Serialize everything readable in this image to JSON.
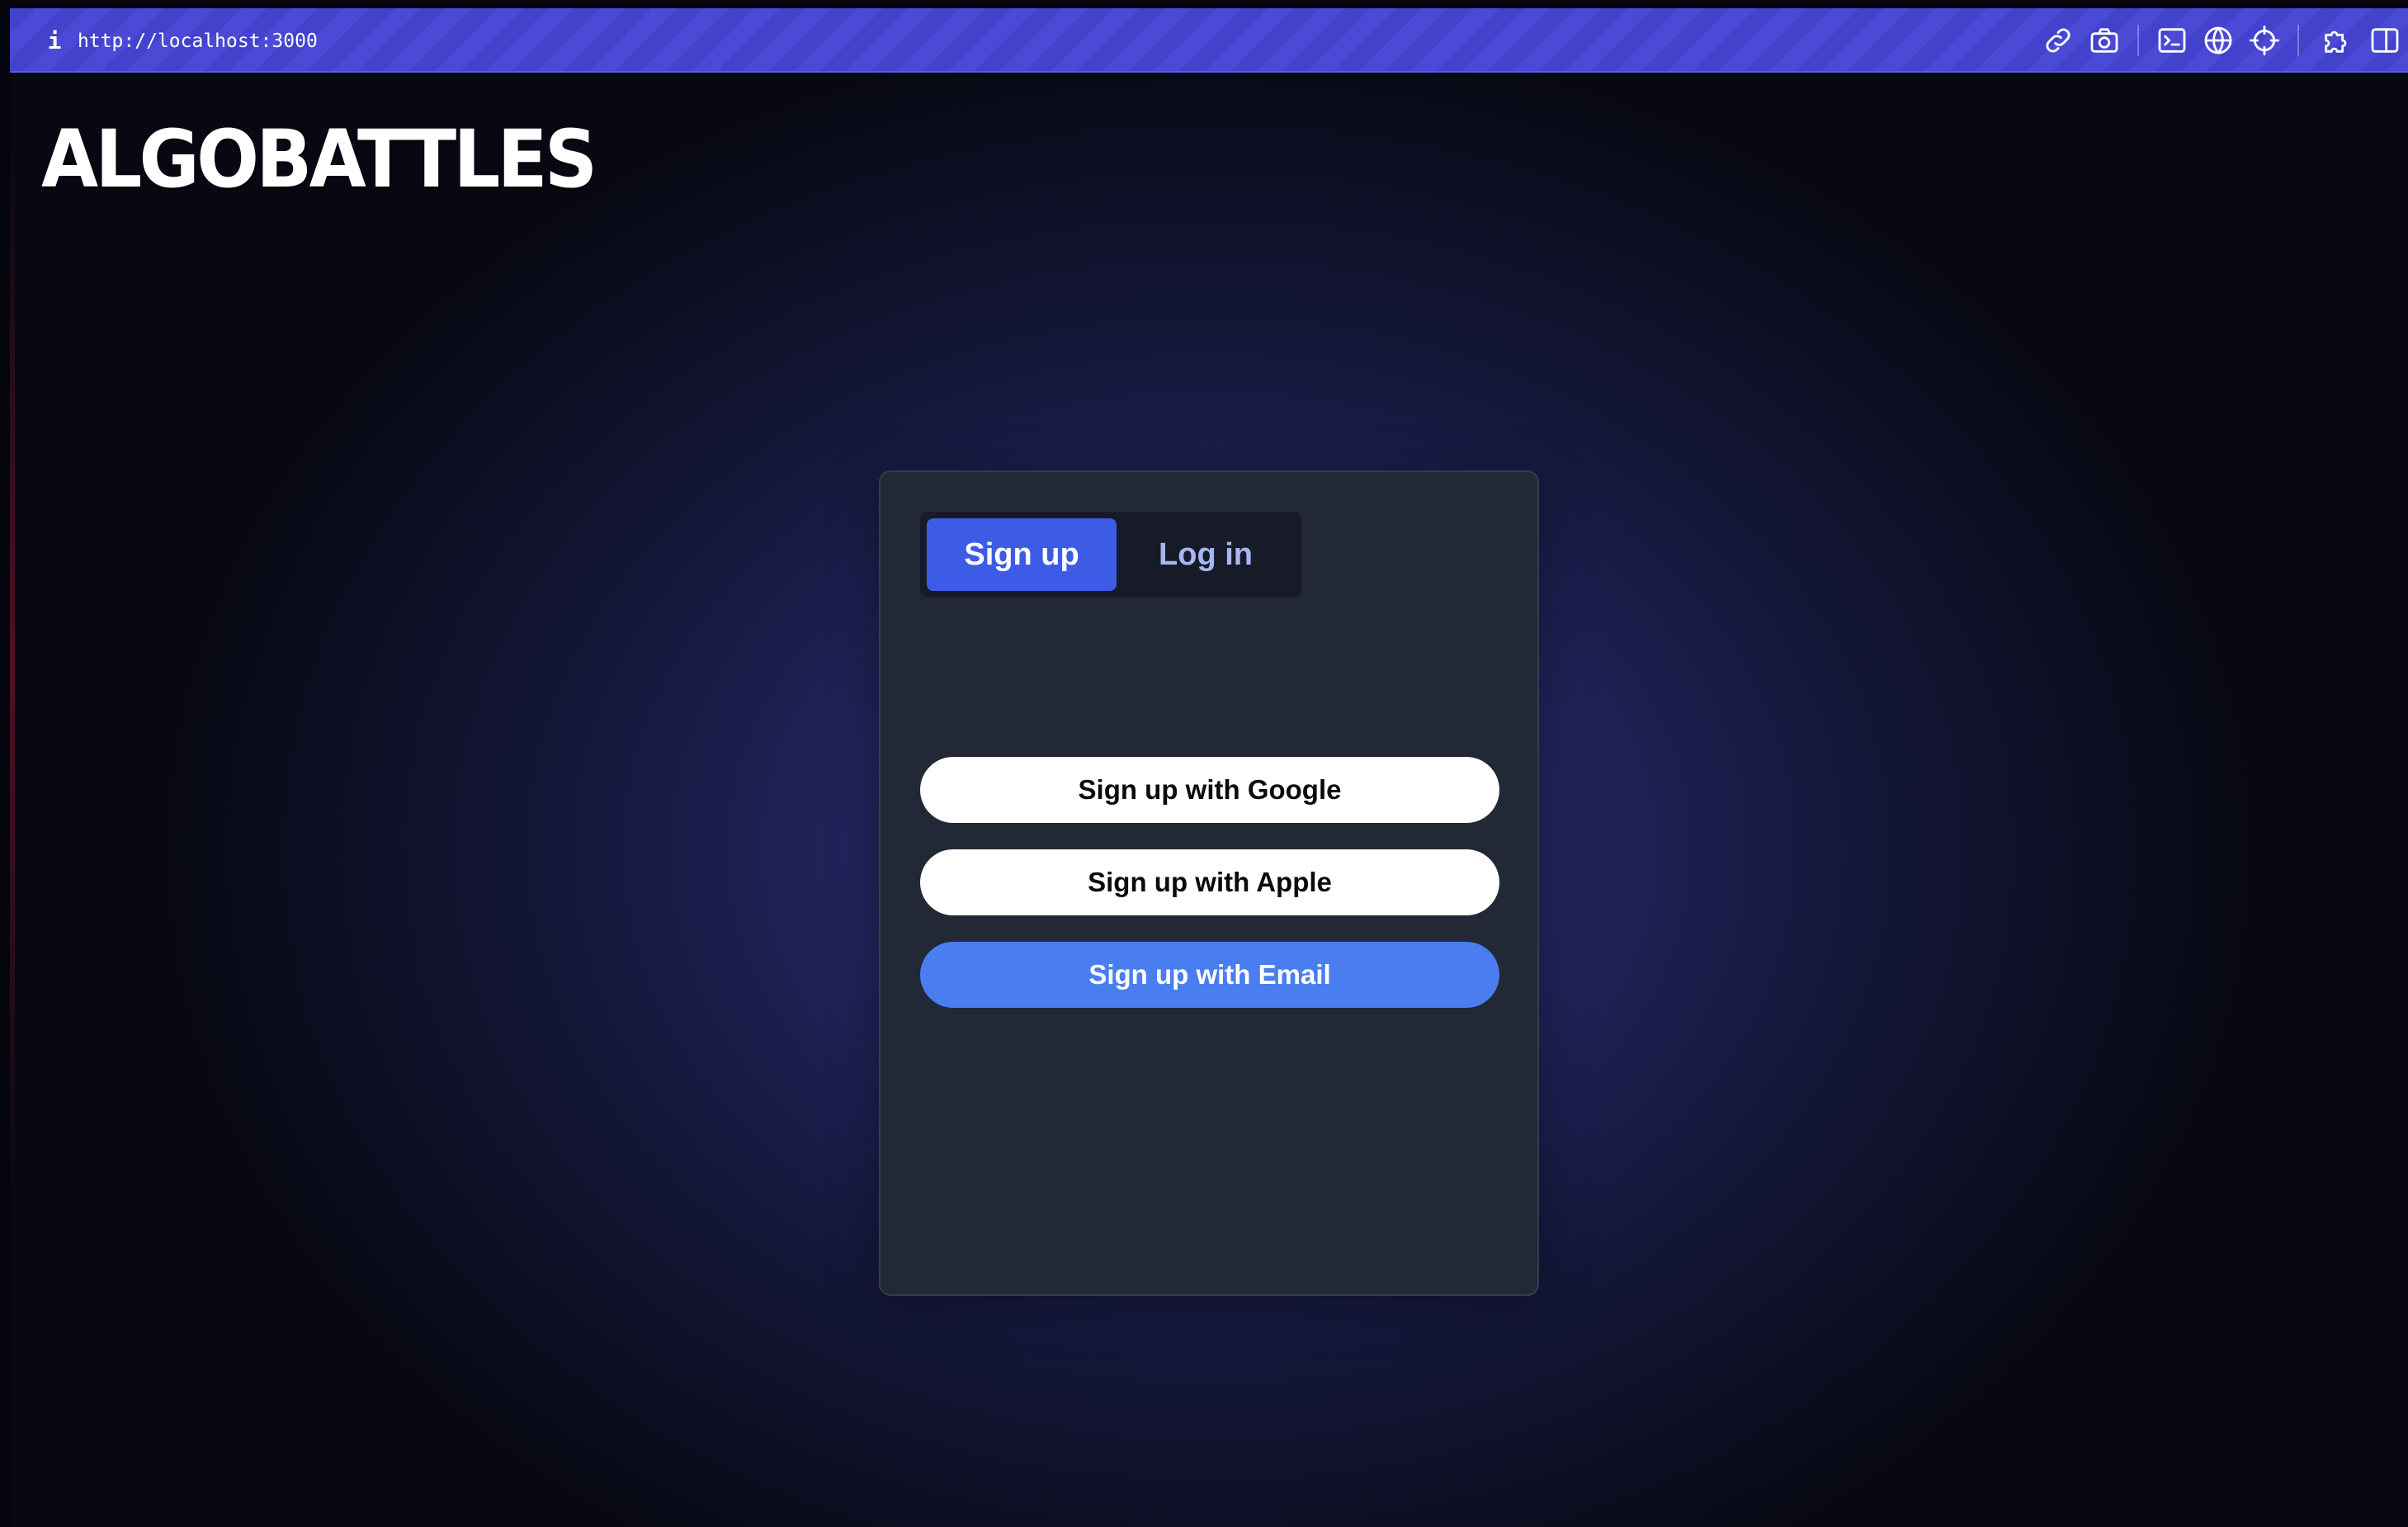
{
  "browser": {
    "url": "http://localhost:3000",
    "info_icon": "i",
    "toolbar_icons": [
      "link-icon",
      "camera-icon",
      "terminal-icon",
      "globe-icon",
      "crosshair-icon",
      "puzzle-icon",
      "split-view-icon"
    ],
    "bar_color": "#4242cc"
  },
  "brand": {
    "logo": "ALGOBATTLES"
  },
  "auth": {
    "tabs": [
      {
        "label": "Sign up",
        "active": true
      },
      {
        "label": "Log in",
        "active": false
      }
    ],
    "buttons": {
      "google": "Sign up with Google",
      "apple": "Sign up with Apple",
      "email": "Sign up with Email"
    },
    "colors": {
      "card": "#222836",
      "tab_active": "#3d5ce6",
      "tab_inactive_text": "#a6b8f2",
      "email_button": "#4a7ef0"
    }
  }
}
